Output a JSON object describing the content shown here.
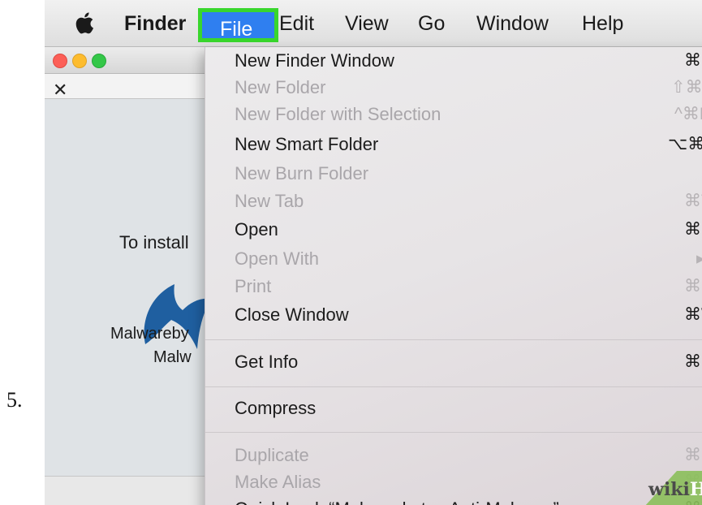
{
  "step": {
    "number": "5."
  },
  "menubar": {
    "apple_icon": "apple-icon",
    "items": [
      {
        "label": "Finder"
      },
      {
        "label": "File"
      },
      {
        "label": "Edit"
      },
      {
        "label": "View"
      },
      {
        "label": "Go"
      },
      {
        "label": "Window"
      },
      {
        "label": "Help"
      }
    ],
    "highlight_color": "#2f7ff0",
    "callout_color": "#39d62d"
  },
  "background_window": {
    "tools_icon": "✕",
    "installer_text": "To install",
    "app_name_line1": "Malwareby",
    "app_name_line2": "Malw",
    "logo_color": "#1f5fa0"
  },
  "file_menu": {
    "items": [
      {
        "label": "New Finder Window",
        "shortcut": "⌘N",
        "enabled": true
      },
      {
        "label": "New Folder",
        "shortcut": "⇧⌘N",
        "enabled": false
      },
      {
        "label": "New Folder with Selection",
        "shortcut": "^⌘N",
        "enabled": false
      },
      {
        "label": "New Smart Folder",
        "shortcut": "⌥⌘N",
        "enabled": true
      },
      {
        "label": "New Burn Folder",
        "shortcut": "",
        "enabled": false
      },
      {
        "label": "New Tab",
        "shortcut": "⌘T",
        "enabled": false
      },
      {
        "label": "Open",
        "shortcut": "⌘O",
        "enabled": true
      },
      {
        "label": "Open With",
        "shortcut": "▸",
        "enabled": false
      },
      {
        "label": "Print",
        "shortcut": "⌘P",
        "enabled": false
      },
      {
        "label": "Close Window",
        "shortcut": "⌘W",
        "enabled": true
      },
      {
        "label": "Get Info",
        "shortcut": "⌘I",
        "enabled": true
      },
      {
        "label": "Compress",
        "shortcut": "",
        "enabled": true
      },
      {
        "label": "Duplicate",
        "shortcut": "⌘D",
        "enabled": false
      },
      {
        "label": "Make Alias",
        "shortcut": "⌘L",
        "enabled": false
      },
      {
        "label": "Quick Look “Malwarebytes Anti-Malware”",
        "shortcut": "⌘Y",
        "enabled": true
      }
    ]
  },
  "watermark": {
    "wiki": "wiki",
    "how": "How"
  }
}
